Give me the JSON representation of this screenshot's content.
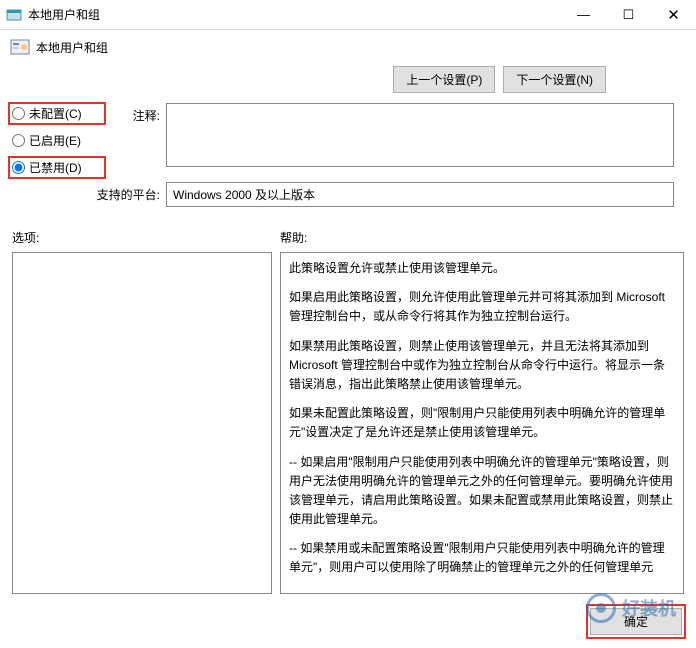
{
  "titlebar": {
    "title": "本地用户和组"
  },
  "section": {
    "title": "本地用户和组"
  },
  "topButtons": {
    "prev": "上一个设置(P)",
    "next": "下一个设置(N)"
  },
  "radios": {
    "not_configured": "未配置(C)",
    "enabled": "已启用(E)",
    "disabled": "已禁用(D)"
  },
  "labels": {
    "comment": "注释:",
    "platform": "支持的平台:",
    "options": "选项:",
    "help": "帮助:"
  },
  "platform": {
    "value": "Windows 2000 及以上版本"
  },
  "help": {
    "p1": "此策略设置允许或禁止使用该管理单元。",
    "p2": "如果启用此策略设置，则允许使用此管理单元并可将其添加到 Microsoft 管理控制台中，或从命令行将其作为独立控制台运行。",
    "p3": "如果禁用此策略设置，则禁止使用该管理单元，并且无法将其添加到 Microsoft 管理控制台中或作为独立控制台从命令行中运行。将显示一条错误消息，指出此策略禁止使用该管理单元。",
    "p4": "如果未配置此策略设置，则\"限制用户只能使用列表中明确允许的管理单元\"设置决定了是允许还是禁止使用该管理单元。",
    "p5": "--  如果启用\"限制用户只能使用列表中明确允许的管理单元\"策略设置，则用户无法使用明确允许的管理单元之外的任何管理单元。要明确允许使用该管理单元，请启用此策略设置。如果未配置或禁用此策略设置，则禁止使用此管理单元。",
    "p6": "--  如果禁用或未配置策略设置\"限制用户只能使用列表中明确允许的管理单元\"，则用户可以使用除了明确禁止的管理单元之外的任何管理单元"
  },
  "bottom": {
    "ok": "确定",
    "watermark": "好装机"
  }
}
